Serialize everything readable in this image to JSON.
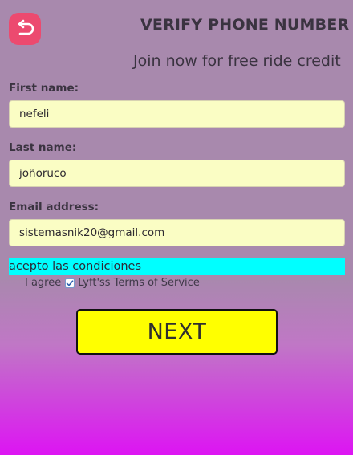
{
  "header": {
    "back_icon": "undo-arrow-icon",
    "title": "VERIFY PHONE NUMBER",
    "subtitle": "Join now for free ride credit"
  },
  "form": {
    "first_name": {
      "label": "First name:",
      "value": "nefeli"
    },
    "last_name": {
      "label": "Last name:",
      "value": "joñoruco"
    },
    "email": {
      "label": "Email address:",
      "value": "sistemasnik20@gmail.com"
    }
  },
  "terms": {
    "banner_text": "acepto las condiciones",
    "agree_prefix": "I agree",
    "agree_suffix": "Lyft'ss Terms of Service",
    "checked": true
  },
  "next_label": "NEXT",
  "colors": {
    "back_button": "#ec4a6f",
    "input_bg": "#fafdc4",
    "banner_bg": "#00ffff",
    "next_button": "#ffff00"
  }
}
